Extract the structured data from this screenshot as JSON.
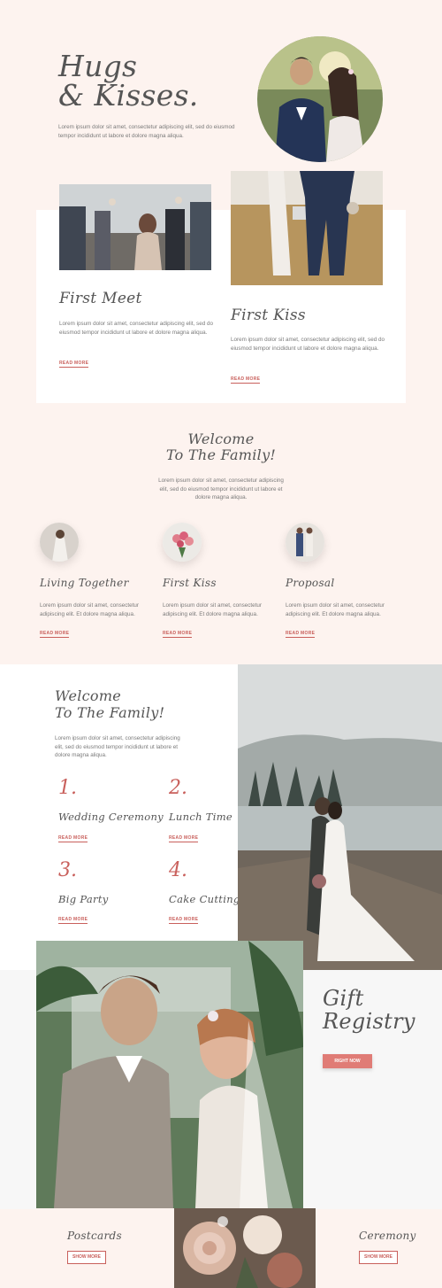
{
  "hero": {
    "title_line1": "Hugs",
    "title_line2": "& Kisses.",
    "text": "Lorem ipsum dolor sit amet, consectetur adipiscing elit, sed do eiusmod tempor incididunt ut labore et dolore magna aliqua."
  },
  "cards": [
    {
      "title": "First Meet",
      "text": "Lorem ipsum dolor sit amet, consectetur adipiscing elit, sed do eiusmod tempor incididunt ut labore et dolore magna aliqua.",
      "link": "READ MORE"
    },
    {
      "title": "First Kiss",
      "text": "Lorem ipsum dolor sit amet, consectetur adipiscing elit, sed do eiusmod tempor incididunt ut labore et dolore magna aliqua.",
      "link": "READ MORE"
    }
  ],
  "welcome": {
    "title_line1": "Welcome",
    "title_line2": "To The Family!",
    "text": "Lorem ipsum dolor sit amet, consectetur adipiscing elit, sed do eiusmod tempor incididunt ut labore et dolore magna aliqua."
  },
  "features": [
    {
      "title": "Living Together",
      "text": "Lorem ipsum dolor sit amet, consectetur adipiscing elit. Et dolore magna aliqua.",
      "link": "READ MORE"
    },
    {
      "title": "First Kiss",
      "text": "Lorem ipsum dolor sit amet, consectetur adipiscing elit. Et dolore magna aliqua.",
      "link": "READ MORE"
    },
    {
      "title": "Proposal",
      "text": "Lorem ipsum dolor sit amet, consectetur adipiscing elit. Et dolore magna aliqua.",
      "link": "READ MORE"
    }
  ],
  "schedule": {
    "title_line1": "Welcome",
    "title_line2": "To The Family!",
    "text": "Lorem ipsum dolor sit amet, consectetur adipiscing elit, sed do eiusmod tempor incididunt ut labore et dolore magna aliqua.",
    "items": [
      {
        "num": "1.",
        "title": "Wedding Ceremony",
        "link": "READ MORE"
      },
      {
        "num": "2.",
        "title": "Lunch Time",
        "link": "READ MORE"
      },
      {
        "num": "3.",
        "title": "Big Party",
        "link": "READ MORE"
      },
      {
        "num": "4.",
        "title": "Cake Cutting",
        "link": "READ MORE"
      }
    ]
  },
  "gift": {
    "title_line1": "Gift",
    "title_line2": "Registry",
    "button": "RIGHT NOW"
  },
  "footer": {
    "left_title": "Postcards",
    "left_button": "SHOW MORE",
    "right_title": "Ceremony",
    "right_button": "SHOW MORE"
  },
  "colors": {
    "background": "#fdf3ef",
    "accent": "#c9605c",
    "button": "#e07c76",
    "text": "#555555"
  }
}
